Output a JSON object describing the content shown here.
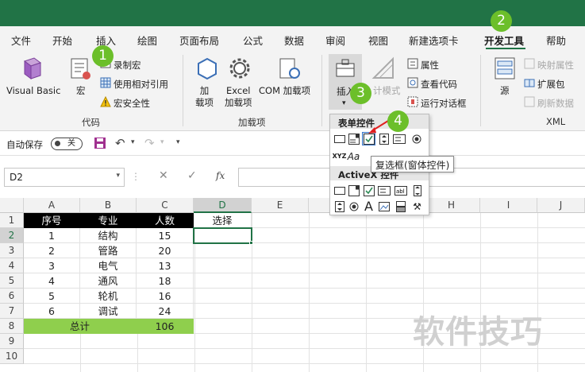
{
  "ribbon_tabs": [
    "文件",
    "开始",
    "插入",
    "绘图",
    "页面布局",
    "公式",
    "数据",
    "审阅",
    "视图",
    "新建选项卡",
    "开发工具",
    "帮助"
  ],
  "ribbon": {
    "code_group": {
      "label": "代码",
      "visual_basic": "Visual Basic",
      "macros": "宏",
      "record_macro": "录制宏",
      "relative_refs": "使用相对引用",
      "macro_security": "宏安全性"
    },
    "addins_group": {
      "label": "加载项",
      "addins": "加\n载项",
      "excel_addins": "Excel\n加载项",
      "com_addins": "COM 加载项"
    },
    "controls_group": {
      "insert": "插入",
      "design_mode": "计模式",
      "properties": "属性",
      "view_code": "查看代码",
      "run_dialog": "运行对话框"
    },
    "xml_group": {
      "label": "XML",
      "source": "源",
      "map_properties": "映射属性",
      "expansion_packs": "扩展包",
      "refresh_data": "刷新数据"
    }
  },
  "qat": {
    "autosave_label": "自动保存",
    "autosave_state": "关"
  },
  "formula_bar": {
    "name_box": "D2",
    "fx": "fx"
  },
  "popup": {
    "form_controls_title": "表单控件",
    "activex_title": "ActiveX 控件"
  },
  "tooltip": "复选框(窗体控件)",
  "badges": [
    "1",
    "2",
    "3",
    "4"
  ],
  "sheet": {
    "columns": [
      "A",
      "B",
      "C",
      "D",
      "E",
      "F",
      "G",
      "H",
      "I",
      "J"
    ],
    "rows": [
      "1",
      "2",
      "3",
      "4",
      "5",
      "6",
      "7",
      "8",
      "9",
      "10"
    ],
    "header": [
      "序号",
      "专业",
      "人数",
      "选择"
    ],
    "data": [
      [
        "1",
        "结构",
        "15"
      ],
      [
        "2",
        "管路",
        "20"
      ],
      [
        "3",
        "电气",
        "13"
      ],
      [
        "4",
        "通风",
        "18"
      ],
      [
        "5",
        "轮机",
        "16"
      ],
      [
        "6",
        "调试",
        "24"
      ]
    ],
    "total_label": "总计",
    "total_value": "106"
  },
  "watermark": "软件技巧",
  "colors": {
    "excel_green": "#217346",
    "badge_green": "#6cbf2a",
    "total_fill": "#8fcf4d"
  }
}
